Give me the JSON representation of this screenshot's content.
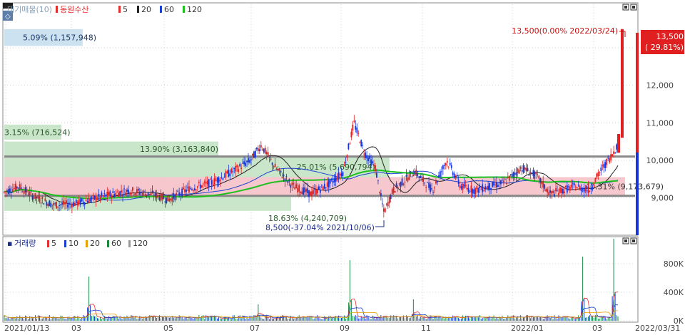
{
  "legend_price": {
    "title": "대기매물(10)",
    "ma_title": "동원수산",
    "periods": [
      "5",
      "20",
      "60",
      "120"
    ],
    "period_colors": [
      "#e03030",
      "#222222",
      "#1a3fd0",
      "#1ec01e"
    ]
  },
  "legend_volume": {
    "title": "거래량",
    "periods": [
      "5",
      "10",
      "20",
      "60",
      "120"
    ],
    "period_colors": [
      "#e03030",
      "#1a3fd0",
      "#e6a000",
      "#1a8a3a",
      "#999999"
    ]
  },
  "colors": {
    "up": "#e02020",
    "down": "#1636d8",
    "band_green": "#c4e3c4",
    "band_pink": "#f5c2c9",
    "band_blue": "#c8dff0",
    "grid": "#d0d0d0",
    "hline": "#888888"
  },
  "annotations": {
    "high_label": "13,500(0.00% 2022/03/24)",
    "low_label": "8,500(-37.04% 2021/10/06)",
    "current_price": "13,500",
    "current_change": "( 29.81%)"
  },
  "chart_data": [
    {
      "type": "candlestick",
      "title": "동원수산",
      "x_tick_labels": [
        "2021/01/13",
        "03",
        "05",
        "07",
        "09",
        "11",
        "2022/01",
        "03",
        "2022/03/31"
      ],
      "y_tick_labels": [
        "9,000",
        "10,000",
        "11,000",
        "12,000",
        "13,000"
      ],
      "ylim": [
        8000,
        14200
      ],
      "price_summary": {
        "start_date": "2021/01/13",
        "end_date": "2022/03/31",
        "high": 13500,
        "high_date": "2022/03/24",
        "low": 8500,
        "low_date": "2021/10/06",
        "last": 13500,
        "last_change_pct": 29.81
      },
      "volume_profile_bands": [
        {
          "label": "5.09% (1,157,948)",
          "low": 13050,
          "high": 13500,
          "color": "blue"
        },
        {
          "label": "3.15% (716,524)",
          "low": 10550,
          "high": 10950,
          "color": "green"
        },
        {
          "label": "13.90% (3,163,840)",
          "low": 10100,
          "high": 10500,
          "color": "green"
        },
        {
          "label": "25.01% (5,690,794)",
          "low": 9550,
          "high": 10100,
          "color": "green"
        },
        {
          "label": "40.31% (9,173,679)",
          "low": 9050,
          "high": 9550,
          "color": "pink"
        },
        {
          "label": "18.63% (4,240,709)",
          "low": 8650,
          "high": 9050,
          "color": "green"
        }
      ],
      "horizontal_levels": [
        10100,
        9050
      ],
      "grid": true
    },
    {
      "type": "bar",
      "title": "거래량",
      "y_tick_labels": [
        "0K",
        "400K",
        "800K"
      ],
      "ylim": [
        0,
        1200000
      ],
      "spikes": [
        {
          "x_index": 60,
          "value": 620000
        },
        {
          "x_index": 180,
          "value": 230000
        },
        {
          "x_index": 245,
          "value": 850000
        },
        {
          "x_index": 290,
          "value": 300000
        },
        {
          "x_index": 410,
          "value": 900000
        },
        {
          "x_index": 432,
          "value": 1150000
        }
      ],
      "grid": true
    }
  ]
}
